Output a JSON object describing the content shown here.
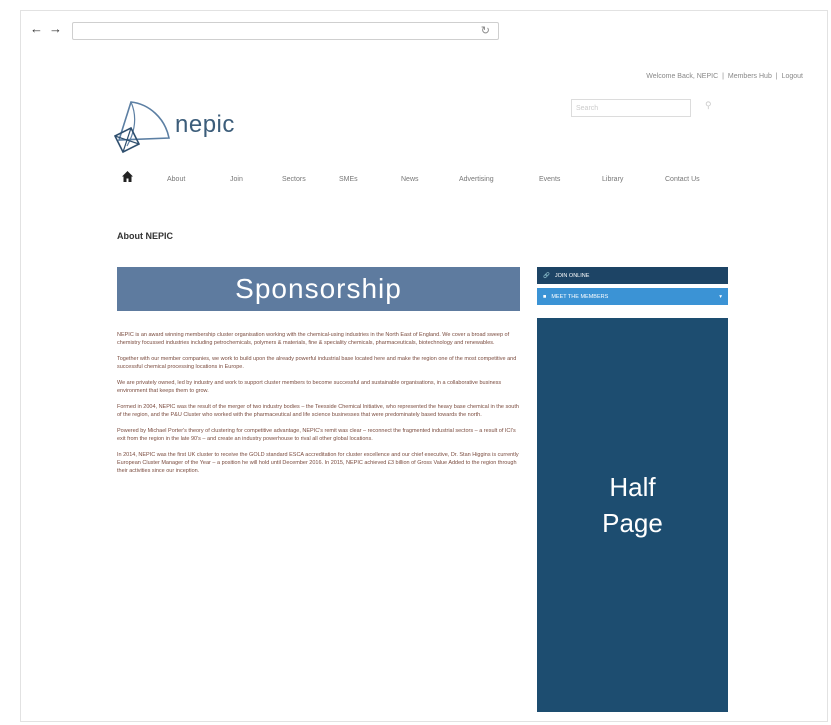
{
  "browser": {
    "back_icon": "back-arrow-icon",
    "forward_icon": "forward-arrow-icon",
    "reload_icon": "reload-icon",
    "url": ""
  },
  "header": {
    "links": [
      "Welcome Back, NEPIC",
      "Members Hub",
      "Logout"
    ],
    "separator": "|",
    "search_placeholder": "Search",
    "search_icon": "search-icon",
    "logo_text": "nepic"
  },
  "nav": {
    "items": [
      "About",
      "Join",
      "Sectors",
      "SMEs",
      "News",
      "Advertising",
      "Events",
      "Library",
      "Contact Us"
    ]
  },
  "main": {
    "heading": "About NEPIC",
    "banner": "Sponsorship",
    "paragraphs": [
      "NEPIC is an award winning membership cluster organisation working with the chemical-using industries in the North East of England. We cover a broad sweep of chemistry focussed industries including petrochemicals, polymers & materials, fine & speciality chemicals, pharmaceuticals, biotechnology and renewables.",
      "Together with our member companies, we work to build upon the already powerful industrial base located here and make the region one of the most competitive and successful chemical processing locations in Europe.",
      "We are privately owned, led by industry and work to support cluster members to become successful and sustainable organisations, in a collaborative business environment that keeps them to grow.",
      "Formed in 2004, NEPIC was the result of the merger of two industry bodies – the Teesside Chemical Initiative, who represented the heavy base chemical in the south of the region, and the P&U Cluster who worked with the pharmaceutical and life science businesses that were predominately based towards the north.",
      "Powered by Michael Porter's theory of clustering for competitive advantage, NEPIC's remit was clear – reconnect the fragmented industrial sectors – a result of ICI's exit from the region in the late 90's – and create an industry powerhouse to rival all other global locations.",
      "In 2014, NEPIC was the first UK cluster to receive the GOLD standard ESCA accreditation for cluster excellence and our chief executive, Dr. Stan Higgins is currently European Cluster Manager of the Year – a position he will hold until December 2016. In 2015, NEPIC achieved £3 billion of Gross Value Added to the region through their activities since our inception."
    ]
  },
  "sidebar": {
    "join_label": "JOIN ONLINE",
    "join_icon": "link-icon",
    "meet_label": "MEET THE MEMBERS",
    "meet_icon": "people-icon",
    "meet_chevron": "chevron-down-icon",
    "ad_line1": "Half",
    "ad_line2": "Page"
  },
  "colors": {
    "banner_bg": "#5e7b9f",
    "join_bg": "#1d4465",
    "meet_bg": "#3b93d5",
    "ad_bg": "#1d4d70",
    "body_text": "#7a4b3e",
    "logo_text": "#3c5d7a"
  }
}
